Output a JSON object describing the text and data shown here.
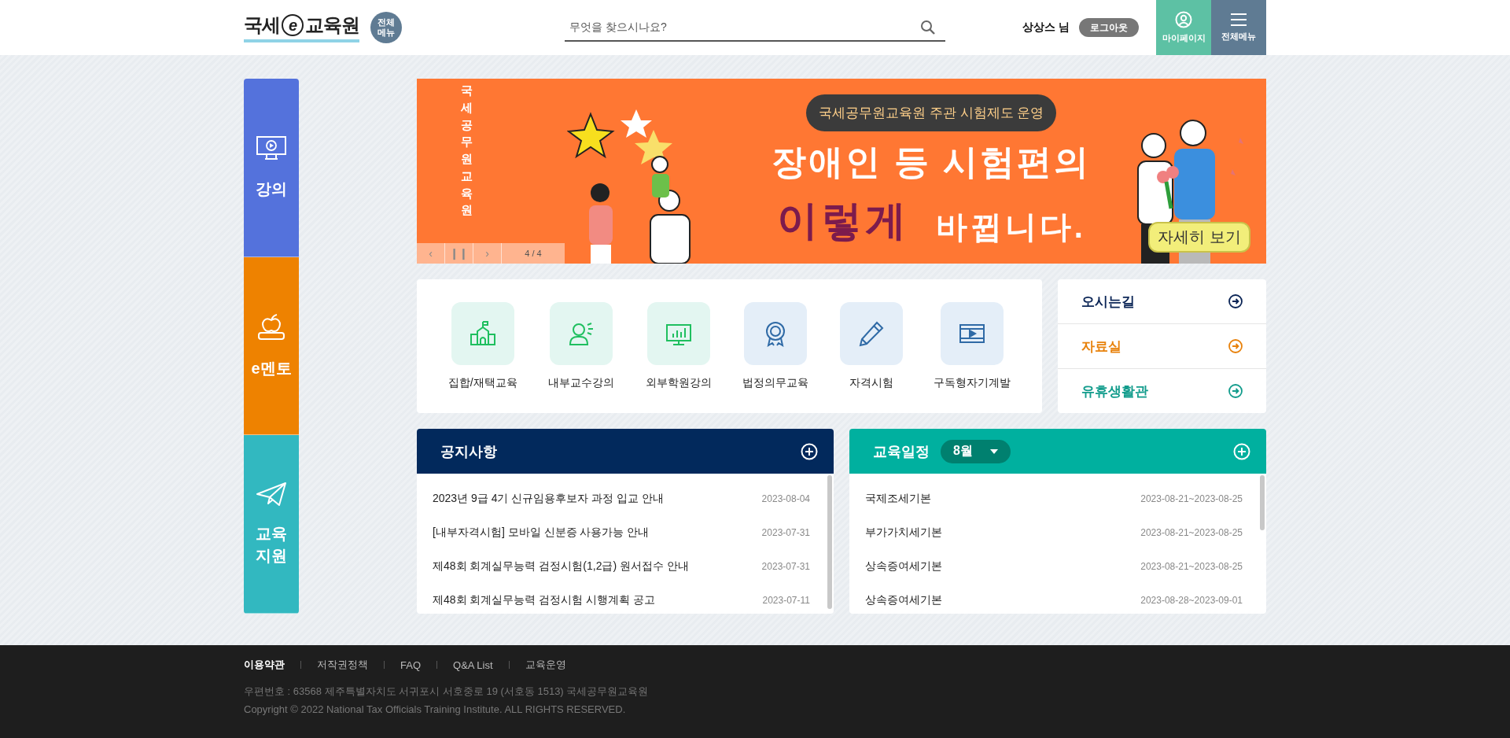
{
  "header": {
    "logo": {
      "left": "국세",
      "mark": "e",
      "right": "교육원"
    },
    "menu_badge": "전체 메뉴",
    "search": {
      "placeholder": "무엇을 찾으시나요?"
    },
    "user": "상상스 님",
    "logout": "로그아웃",
    "buttons": [
      {
        "kind": "mypage",
        "label": "마이페이지",
        "color": "#5dc1a4"
      },
      {
        "kind": "menu",
        "label": "전체메뉴",
        "color": "#5f7b93"
      }
    ]
  },
  "side_nav": [
    {
      "kind": "lecture",
      "label": "강의",
      "color": "#5472dc"
    },
    {
      "kind": "mentor",
      "label": "e멘토",
      "color": "#ee8200"
    },
    {
      "kind": "support",
      "label": "교육 지원",
      "color": "#32b8c0"
    }
  ],
  "banner": {
    "vertical_text": "국세공무원교육원",
    "pill": "국세공무원교육원 주관 시험제도 운영",
    "headline": "장애인 등 시험편의",
    "highlight": "이렇게",
    "tail": "바뀝니다.",
    "cta": "자세히 보기",
    "prev": "‹",
    "pause": "❙❙",
    "next": "›",
    "counter": "4 / 4"
  },
  "quick_menu": [
    {
      "kind": "building",
      "label": "집합/재택교육",
      "color": "#1fbf5f"
    },
    {
      "kind": "speaker",
      "label": "내부교수강의",
      "color": "#1fbf5f"
    },
    {
      "kind": "chart",
      "label": "외부학원강의",
      "color": "#1fbf5f"
    },
    {
      "kind": "medal",
      "label": "법정의무교육",
      "color": "#2f6aa6"
    },
    {
      "kind": "pencil",
      "label": "자격시험",
      "color": "#2f6aa6"
    },
    {
      "kind": "video",
      "label": "구독형자기계발",
      "color": "#2f6aa6"
    }
  ],
  "links": [
    {
      "label": "오시는길",
      "color": "#0b2556"
    },
    {
      "label": "자료실",
      "color": "#e8820c"
    },
    {
      "label": "유휴생활관",
      "color": "#129c8c"
    }
  ],
  "notice": {
    "title": "공지사항",
    "items": [
      {
        "title": "2023년 9급 4기 신규임용후보자 과정 입교 안내",
        "date": "2023-08-04"
      },
      {
        "title": "[내부자격시험] 모바일 신분증 사용가능 안내",
        "date": "2023-07-31"
      },
      {
        "title": "제48회 회계실무능력 검정시험(1,2급) 원서접수 안내",
        "date": "2023-07-31"
      },
      {
        "title": "제48회 회계실무능력 검정시험 시행계획 공고",
        "date": "2023-07-11"
      }
    ]
  },
  "schedule": {
    "title": "교육일정",
    "month": "8월",
    "items": [
      {
        "title": "국제조세기본",
        "date": "2023-08-21~2023-08-25"
      },
      {
        "title": "부가가치세기본",
        "date": "2023-08-21~2023-08-25"
      },
      {
        "title": "상속증여세기본",
        "date": "2023-08-21~2023-08-25"
      },
      {
        "title": "상속증여세기본",
        "date": "2023-08-28~2023-09-01"
      }
    ]
  },
  "footer": {
    "links": [
      {
        "label": "이용약관",
        "selected": true
      },
      {
        "label": "저작권정책",
        "selected": false
      },
      {
        "label": "FAQ",
        "selected": false
      },
      {
        "label": "Q&A List",
        "selected": false
      },
      {
        "label": "교육운영",
        "selected": false
      }
    ],
    "address": "우편번호 : 63568 제주특별자치도 서귀포시 서호중로 19 (서호동 1513) 국세공무원교육원",
    "copyright": "Copyright © 2022 National Tax Officials Training Institute. ALL RIGHTS RESERVED."
  }
}
